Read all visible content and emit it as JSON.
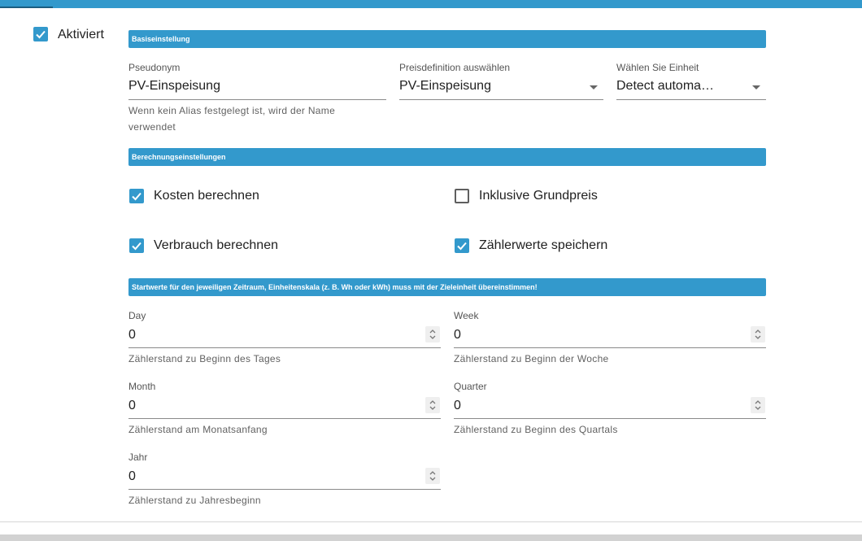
{
  "enabled": {
    "label": "Aktiviert",
    "checked": true
  },
  "sections": {
    "basic": "Basiseinstellung",
    "calc": "Berechnungseinstellungen",
    "start": "Startwerte für den jeweiligen Zeitraum, Einheitenskala (z. B. Wh oder kWh) muss mit der Zieleinheit übereinstimmen!"
  },
  "alias": {
    "label": "Pseudonym",
    "value": "PV-Einspeisung",
    "hint_line1": "Wenn kein Alias festgelegt ist, wird der Name",
    "hint_line2": "verwendet"
  },
  "price": {
    "label": "Preisdefinition auswählen",
    "value": "PV-Einspeisung"
  },
  "unit": {
    "label": "Wählen Sie Einheit",
    "value": "Detect automa…"
  },
  "calc": {
    "costs": {
      "label": "Kosten berechnen",
      "checked": true
    },
    "base_price": {
      "label": "Inklusive Grundpreis",
      "checked": false
    },
    "consumption": {
      "label": "Verbrauch berechnen",
      "checked": true
    },
    "store_meter": {
      "label": "Zählerwerte speichern",
      "checked": true
    }
  },
  "start": {
    "day": {
      "label": "Day",
      "value": "0",
      "hint": "Zählerstand zu Beginn des Tages"
    },
    "week": {
      "label": "Week",
      "value": "0",
      "hint": "Zählerstand zu Beginn der Woche"
    },
    "month": {
      "label": "Month",
      "value": "0",
      "hint": "Zählerstand am Monatsanfang"
    },
    "quarter": {
      "label": "Quarter",
      "value": "0",
      "hint": "Zählerstand zu Beginn des Quartals"
    },
    "year": {
      "label": "Jahr",
      "value": "0",
      "hint": "Zählerstand zu Jahresbeginn"
    }
  },
  "colors": {
    "accent": "#3399cc",
    "tab_indicator": "#1b5d80"
  },
  "icons": {
    "check": "check-icon",
    "dropdown": "caret-down-icon",
    "spinner": "spin-updown-icon"
  }
}
